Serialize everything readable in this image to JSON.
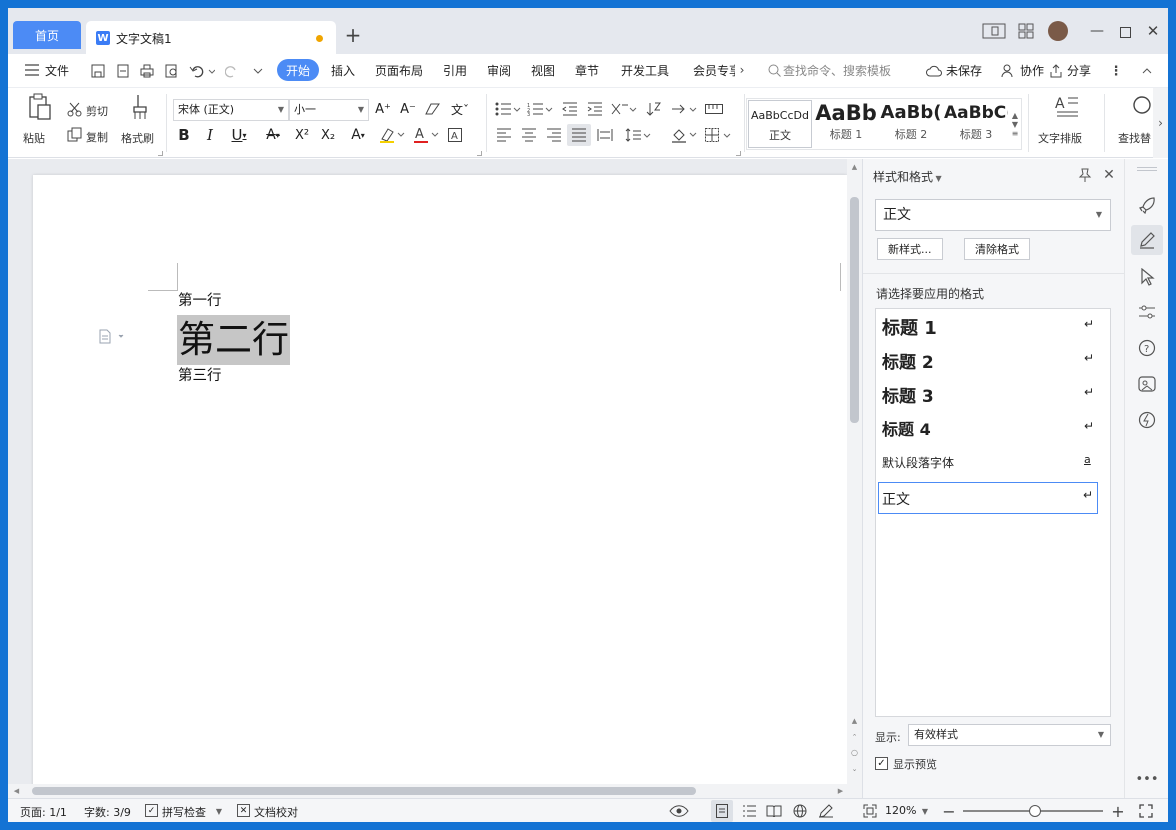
{
  "tabs": {
    "home": "首页",
    "doc_title": "文字文稿1",
    "new_tab": "+"
  },
  "menu": {
    "file": "文件",
    "items": [
      "开始",
      "插入",
      "页面布局",
      "引用",
      "审阅",
      "视图",
      "章节",
      "开发工具",
      "会员专享"
    ],
    "search_placeholder": "查找命令、搜索模板",
    "unsaved": "未保存",
    "collab": "协作",
    "share": "分享"
  },
  "ribbon": {
    "paste": "粘贴",
    "cut": "剪切",
    "copy": "复制",
    "format_painter": "格式刷",
    "font_name": "宋体 (正文)",
    "font_size": "小一",
    "styles": [
      {
        "sample": "AaBbCcDd",
        "label": "正文"
      },
      {
        "sample": "AaBb",
        "label": "标题 1"
      },
      {
        "sample": "AaBb(",
        "label": "标题 2"
      },
      {
        "sample": "AaBbC(",
        "label": "标题 3"
      }
    ],
    "text_layout": "文字排版",
    "find_replace": "查找替"
  },
  "document": {
    "lines": [
      "第一行",
      "第二行",
      "第三行"
    ]
  },
  "panel": {
    "title": "样式和格式",
    "current_style": "正文",
    "new_style": "新样式...",
    "clear_format": "清除格式",
    "choose_label": "请选择要应用的格式",
    "style_items": [
      {
        "name": "标题  1",
        "mark": "↵"
      },
      {
        "name": "标题  2",
        "mark": "↵"
      },
      {
        "name": "标题  3",
        "mark": "↵"
      },
      {
        "name": "标题  4",
        "mark": "↵"
      },
      {
        "name": "默认段落字体",
        "mark": "a"
      },
      {
        "name": "正文",
        "mark": "↵"
      }
    ],
    "show_label": "显示:",
    "show_value": "有效样式",
    "preview_label": "显示预览"
  },
  "status": {
    "page": "页面: 1/1",
    "words": "字数: 3/9",
    "spellcheck": "拼写检查",
    "proofread": "文档校对",
    "zoom": "120%"
  },
  "colors": {
    "accent": "#4c8bf5",
    "desktop": "#1473d4",
    "selection": "#c6c6c6"
  }
}
